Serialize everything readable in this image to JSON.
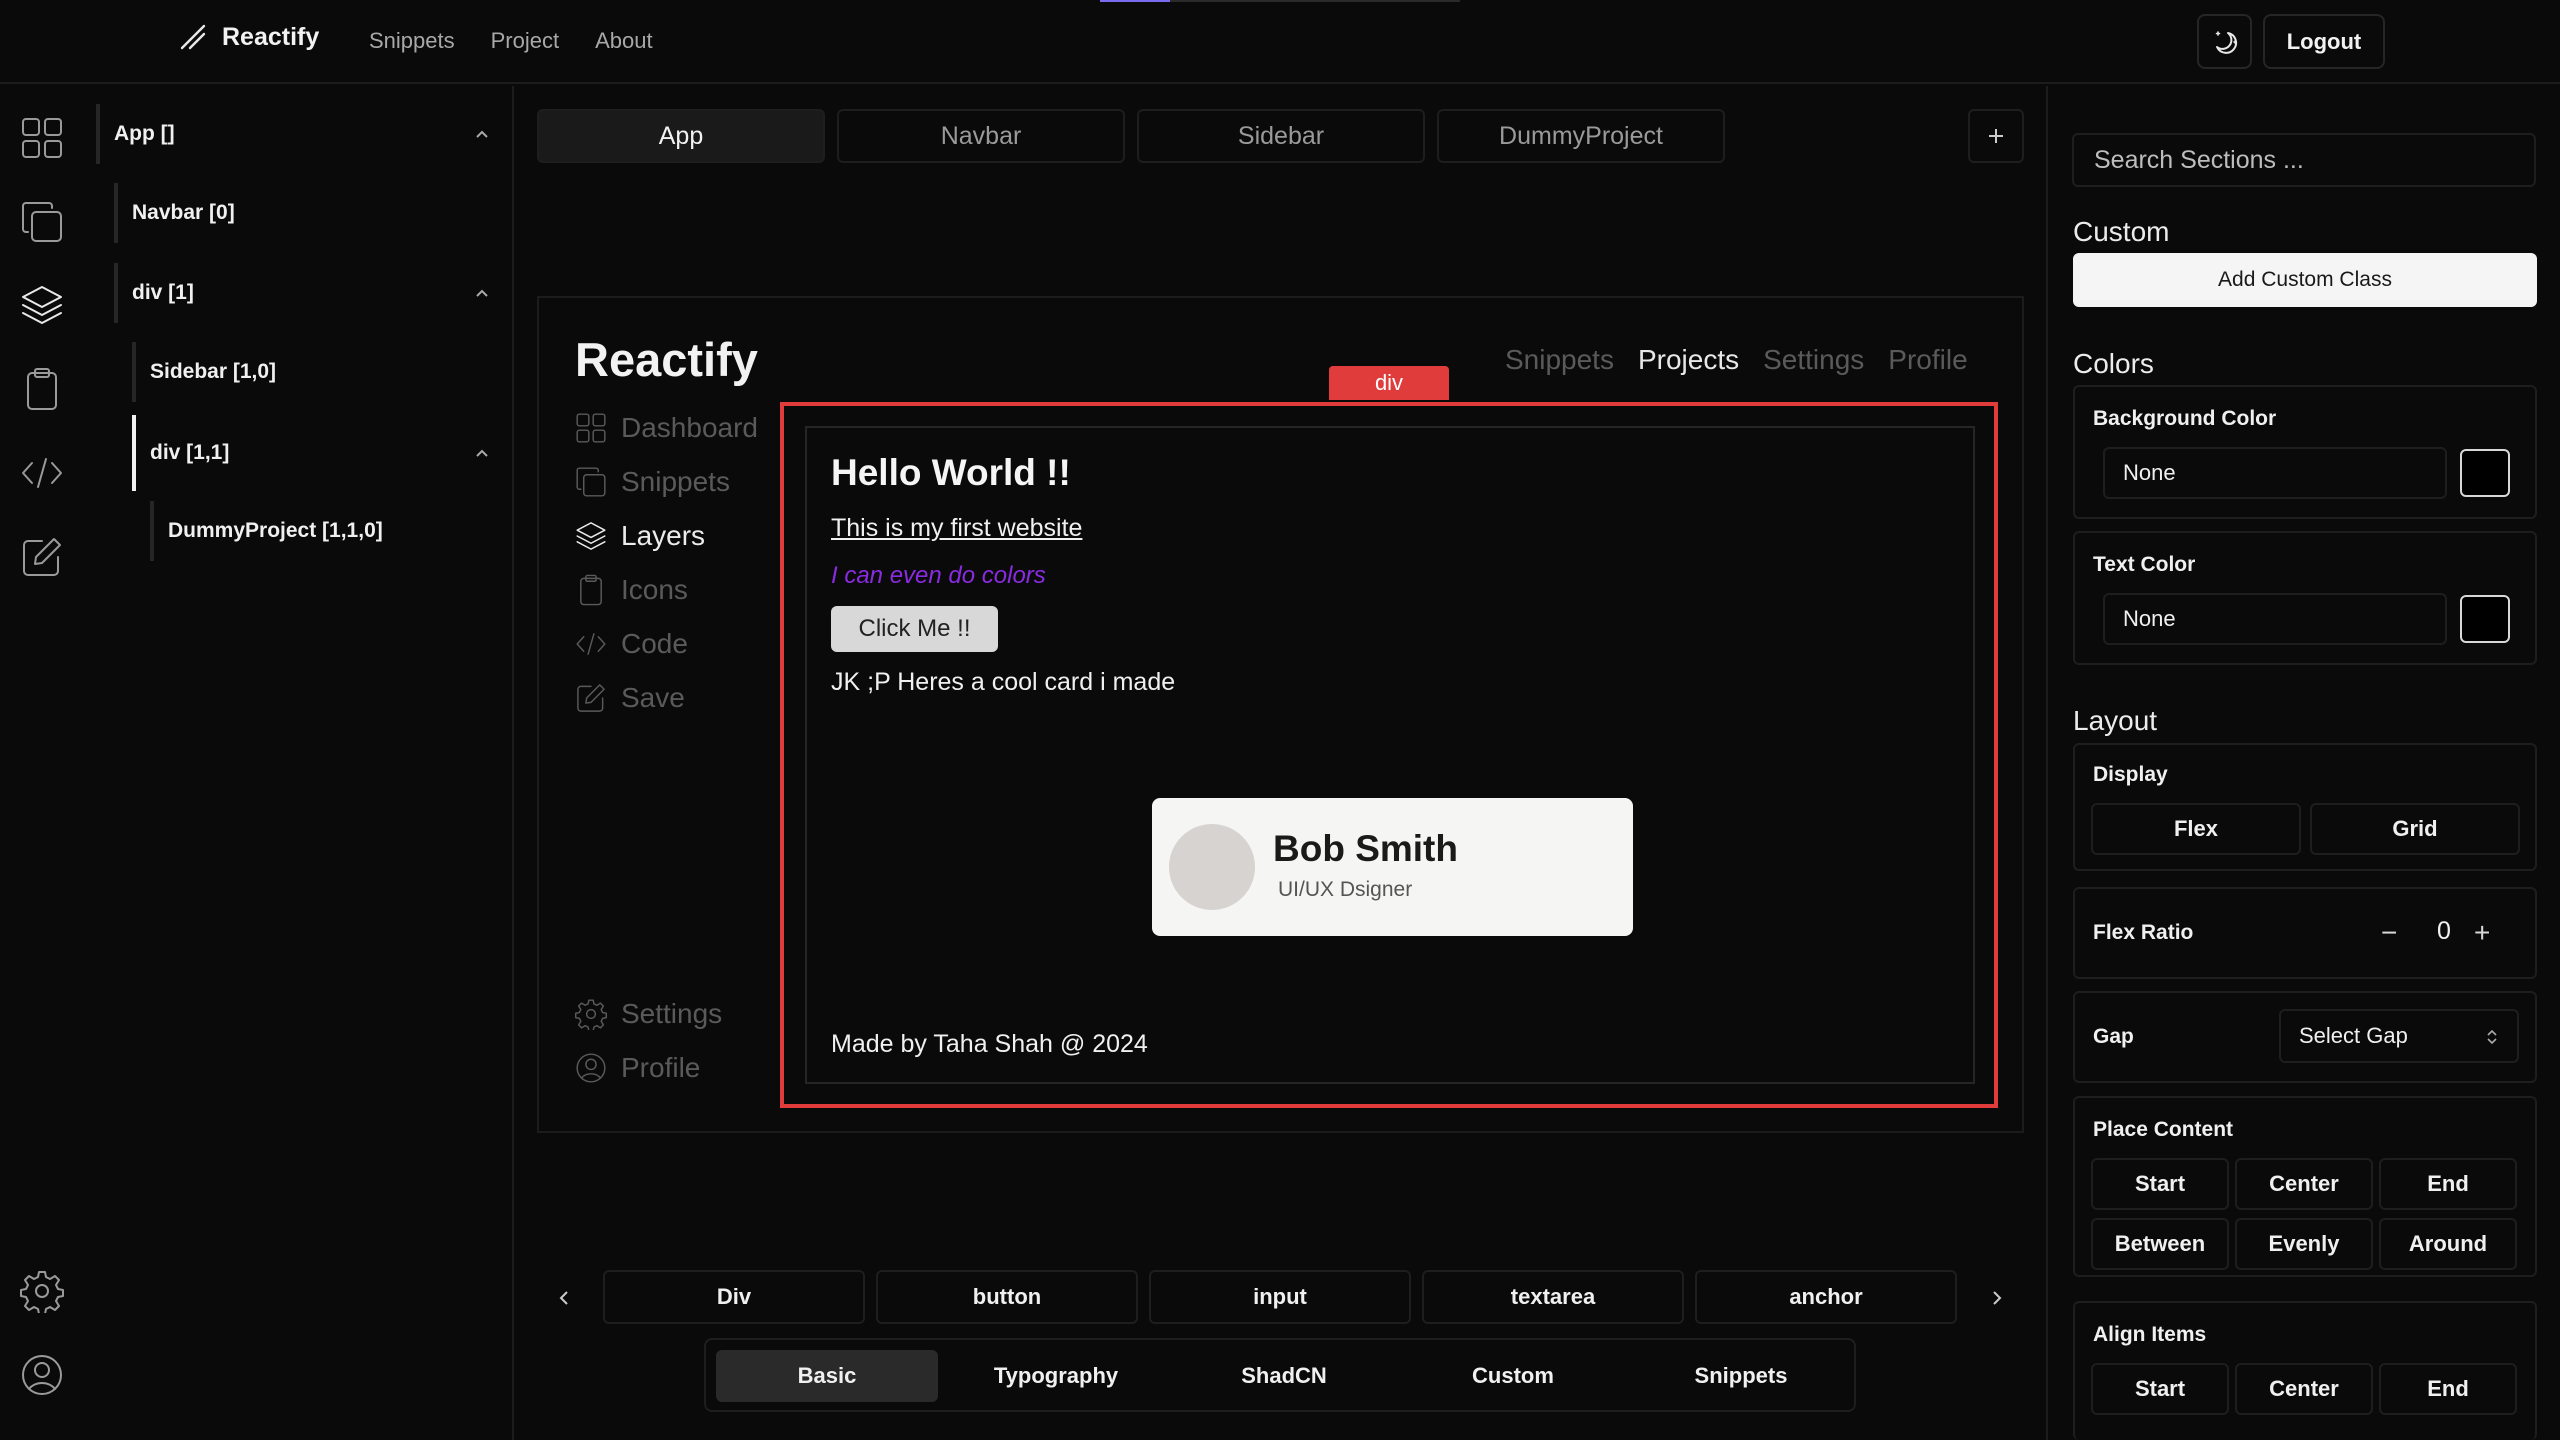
{
  "header": {
    "brand": "Reactify",
    "nav": [
      "Snippets",
      "Project",
      "About"
    ],
    "logout_label": "Logout"
  },
  "rail": {
    "top_icons": [
      "dashboard-icon",
      "snippets-icon",
      "layers-icon",
      "clipboard-icon",
      "code-icon",
      "edit-icon"
    ],
    "bottom_icons": [
      "settings-icon",
      "profile-icon"
    ]
  },
  "layers": [
    {
      "label": "App []",
      "depth": 0,
      "collapsible": true,
      "active": false
    },
    {
      "label": "Navbar [0]",
      "depth": 1,
      "collapsible": false,
      "active": false
    },
    {
      "label": "div [1]",
      "depth": 1,
      "collapsible": true,
      "active": false
    },
    {
      "label": "Sidebar [1,0]",
      "depth": 2,
      "collapsible": false,
      "active": false
    },
    {
      "label": "div [1,1]",
      "depth": 2,
      "collapsible": true,
      "active": true
    },
    {
      "label": "DummyProject [1,1,0]",
      "depth": 3,
      "collapsible": false,
      "active": false
    }
  ],
  "page_tabs": [
    {
      "label": "App",
      "active": true
    },
    {
      "label": "Navbar",
      "active": false
    },
    {
      "label": "Sidebar",
      "active": false
    },
    {
      "label": "DummyProject",
      "active": false
    }
  ],
  "preview": {
    "logo": "Reactify",
    "nav": [
      {
        "label": "Snippets",
        "active": false
      },
      {
        "label": "Projects",
        "active": true
      },
      {
        "label": "Settings",
        "active": false
      },
      {
        "label": "Profile",
        "active": false
      }
    ],
    "sidebar_top": [
      {
        "label": "Dashboard",
        "icon": "dashboard-icon",
        "active": false
      },
      {
        "label": "Snippets",
        "icon": "snippets-icon",
        "active": false
      },
      {
        "label": "Layers",
        "icon": "layers-icon",
        "active": true
      },
      {
        "label": "Icons",
        "icon": "clipboard-icon",
        "active": false
      },
      {
        "label": "Code",
        "icon": "code-icon",
        "active": false
      },
      {
        "label": "Save",
        "icon": "edit-icon",
        "active": false
      }
    ],
    "sidebar_bottom": [
      {
        "label": "Settings",
        "icon": "settings-icon",
        "active": false
      },
      {
        "label": "Profile",
        "icon": "profile-icon",
        "active": false
      }
    ],
    "selection_label": "div",
    "selection_color": "#e03c3c",
    "content": {
      "heading": "Hello World !!",
      "link": "This is my first website",
      "colored_text": "I can even do colors",
      "colored_text_color": "#8a2be2",
      "button": "Click Me !!",
      "caption": "JK ;P Heres a cool card i made",
      "card_name": "Bob Smith",
      "card_role": "UI/UX Dsigner",
      "footer": "Made by Taha Shah @ 2024"
    }
  },
  "components": [
    "Div",
    "button",
    "input",
    "textarea",
    "anchor"
  ],
  "categories": [
    {
      "label": "Basic",
      "active": true
    },
    {
      "label": "Typography",
      "active": false
    },
    {
      "label": "ShadCN",
      "active": false
    },
    {
      "label": "Custom",
      "active": false
    },
    {
      "label": "Snippets",
      "active": false
    }
  ],
  "panel": {
    "search_placeholder": "Search Sections ...",
    "custom": {
      "title": "Custom",
      "add_button": "Add Custom Class"
    },
    "colors": {
      "title": "Colors",
      "background": {
        "label": "Background Color",
        "value": "None"
      },
      "text": {
        "label": "Text Color",
        "value": "None"
      }
    },
    "layout": {
      "title": "Layout",
      "display": {
        "label": "Display",
        "options": [
          "Flex",
          "Grid"
        ]
      },
      "flex_ratio": {
        "label": "Flex Ratio",
        "value": "0"
      },
      "gap": {
        "label": "Gap",
        "placeholder": "Select Gap"
      },
      "place_content": {
        "label": "Place Content",
        "options": [
          "Start",
          "Center",
          "End",
          "Between",
          "Evenly",
          "Around"
        ]
      },
      "align_items": {
        "label": "Align Items",
        "options": [
          "Start",
          "Center",
          "End"
        ]
      }
    }
  }
}
